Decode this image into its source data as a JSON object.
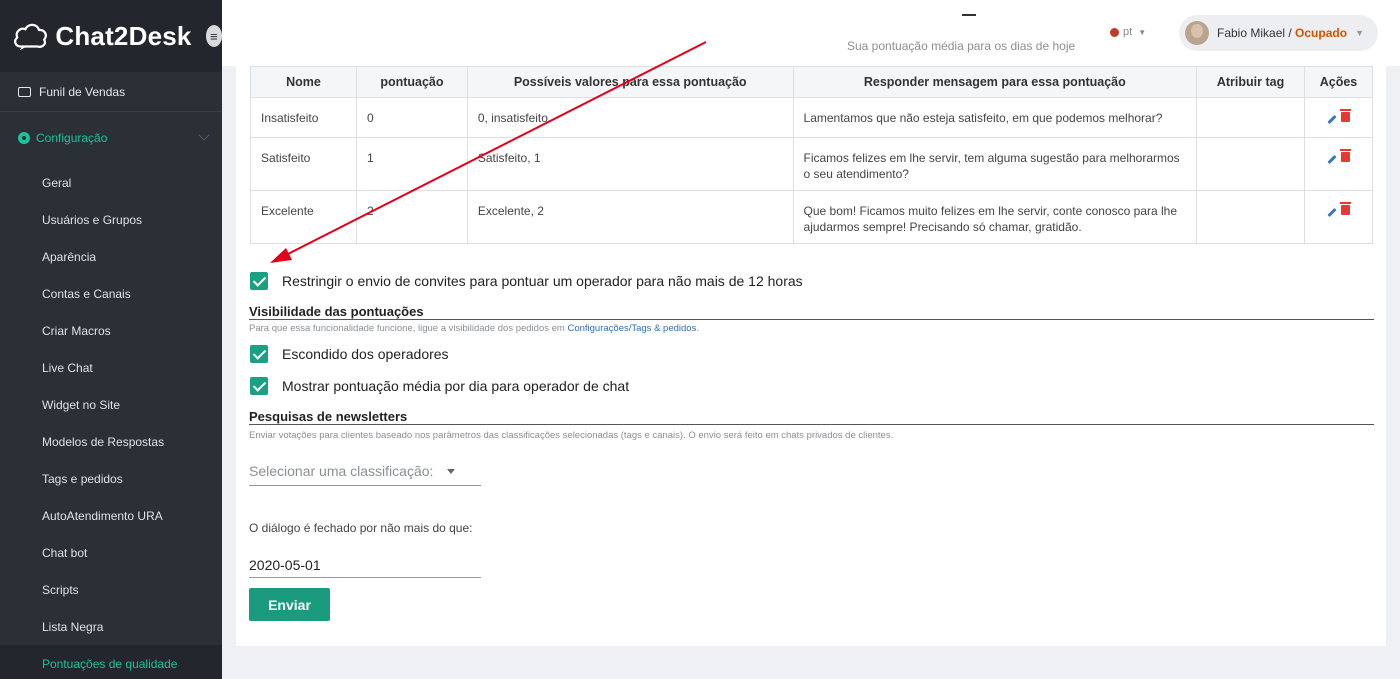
{
  "app": {
    "brand": "Chat2Desk"
  },
  "header": {
    "rating_value": "–",
    "rating_caption": "Sua pontuação média para os dias de hoje",
    "language": "pt",
    "user_name": "Fabio Mikael",
    "separator": " / ",
    "user_status": "Ocupado"
  },
  "sidebar": {
    "top_item": "Funil de Vendas",
    "section": "Configuração",
    "items": [
      "Geral",
      "Usuários e Grupos",
      "Aparência",
      "Contas e Canais",
      "Criar Macros",
      "Live Chat",
      "Widget no Site",
      "Modelos de Respostas",
      "Tags e pedidos",
      "AutoAtendimento URA",
      "Chat bot",
      "Scripts",
      "Lista Negra",
      "Pontuações de qualidade"
    ],
    "active_item": "Pontuações de qualidade"
  },
  "table": {
    "columns": [
      "Nome",
      "pontuação",
      "Possíveis valores para essa pontuação",
      "Responder mensagem para essa pontuação",
      "Atribuir tag",
      "Ações"
    ],
    "rows": [
      {
        "name": "Insatisfeito",
        "score": "0",
        "values": "0, insatisfeito",
        "reply": "Lamentamos que não esteja satisfeito, em que podemos melhorar?",
        "tag": ""
      },
      {
        "name": "Satisfeito",
        "score": "1",
        "values": "Satisfeito, 1",
        "reply": "Ficamos felizes em lhe servir, tem alguma sugestão para melhorarmos o seu atendimento?",
        "tag": ""
      },
      {
        "name": "Excelente",
        "score": "2",
        "values": "Excelente, 2",
        "reply": "Que bom! Ficamos muito felizes em lhe servir, conte conosco para lhe ajudarmos sempre! Precisando só chamar, gratidão.",
        "tag": ""
      }
    ]
  },
  "restrict": {
    "label": "Restringir o envio de convites para pontuar um operador para não mais de 12 horas",
    "checked": true
  },
  "visibility": {
    "title": "Visibilidade das pontuações",
    "hint": "Para que essa funcionalidade funcione, ligue a visibilidade dos pedidos em ",
    "hint_link": "Configurações/Tags & pedidos",
    "hint_end": ".",
    "hidden_label": "Escondido dos operadores",
    "hidden_checked": true,
    "daily_label": "Mostrar pontuação média por dia para operador de chat",
    "daily_checked": true
  },
  "newsletter": {
    "title": "Pesquisas de newsletters",
    "hint": "Enviar votações para clientes baseado nos parâmetros das classificações selecionadas (tags e canais). O envio será feito em chats privados de clientes.",
    "select_placeholder": "Selecionar uma classificação:",
    "date_label": "O diálogo é fechado por não mais do que:",
    "date_value": "2020-05-01",
    "send_label": "Enviar"
  },
  "colors": {
    "accent": "#1a9b7d",
    "sidebar_bg": "#2b2f36",
    "active_text": "#19c39c",
    "status": "#d35400",
    "arrow": "#e3001b"
  }
}
